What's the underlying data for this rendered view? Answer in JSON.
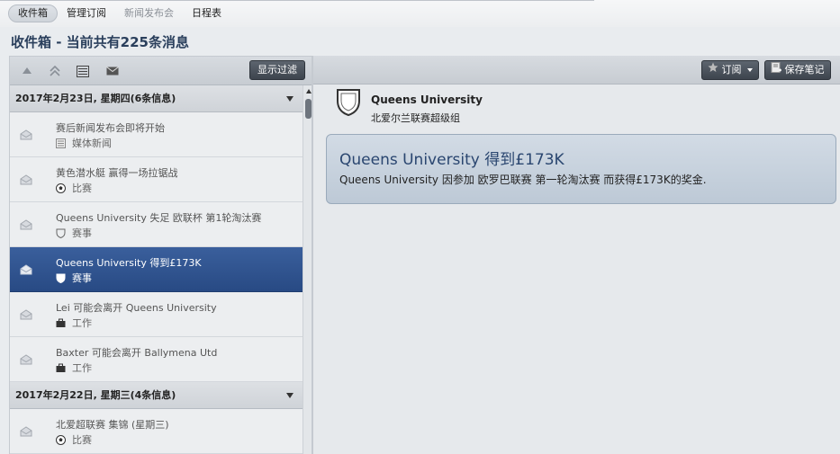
{
  "tabs": [
    {
      "label": "收件箱"
    },
    {
      "label": "管理订阅"
    },
    {
      "label": "新闻发布会"
    },
    {
      "label": "日程表"
    }
  ],
  "page_title": "收件箱 - 当前共有225条消息",
  "left_toolbar": {
    "filter_label": "显示过滤",
    "icons": [
      "arrow-up-icon",
      "double-arrow-up-icon",
      "list-icon",
      "envelope-icon"
    ]
  },
  "groups": [
    {
      "header": "2017年2月23日, 星期四(6条信息)",
      "items": [
        {
          "title": "赛后新闻发布会即将开始",
          "category": "媒体新闻",
          "icon": "newspaper-icon"
        },
        {
          "title": "黄色潜水艇 赢得一场拉锯战",
          "category": "比赛",
          "icon": "football-icon"
        },
        {
          "title": "Queens University 失足 欧联杯 第1轮淘汰赛",
          "category": "赛事",
          "icon": "shield-icon"
        },
        {
          "title": "Queens University 得到£173K",
          "category": "赛事",
          "icon": "shield-icon",
          "selected": true
        },
        {
          "title": "Lei 可能会离开 Queens University",
          "category": "工作",
          "icon": "briefcase-icon"
        },
        {
          "title": "Baxter 可能会离开 Ballymena Utd",
          "category": "工作",
          "icon": "briefcase-icon"
        }
      ]
    },
    {
      "header": "2017年2月22日, 星期三(4条信息)",
      "items": [
        {
          "title": "北爱超联赛 集锦 (星期三)",
          "category": "比赛",
          "icon": "football-icon"
        }
      ]
    }
  ],
  "right_toolbar": {
    "subscribe_label": "订阅",
    "save_notes_label": "保存笔记"
  },
  "detail": {
    "club_name": "Queens University",
    "club_league": "北爱尔兰联赛超级组",
    "message_title": "Queens University 得到£173K",
    "message_body": "Queens University 因参加 欧罗巴联赛 第一轮淘汰赛 而获得£173K的奖金."
  },
  "colors": {
    "selected_row": "#2e5290",
    "title_text": "#2a3f5c",
    "card_bg": "#c8d3df"
  }
}
